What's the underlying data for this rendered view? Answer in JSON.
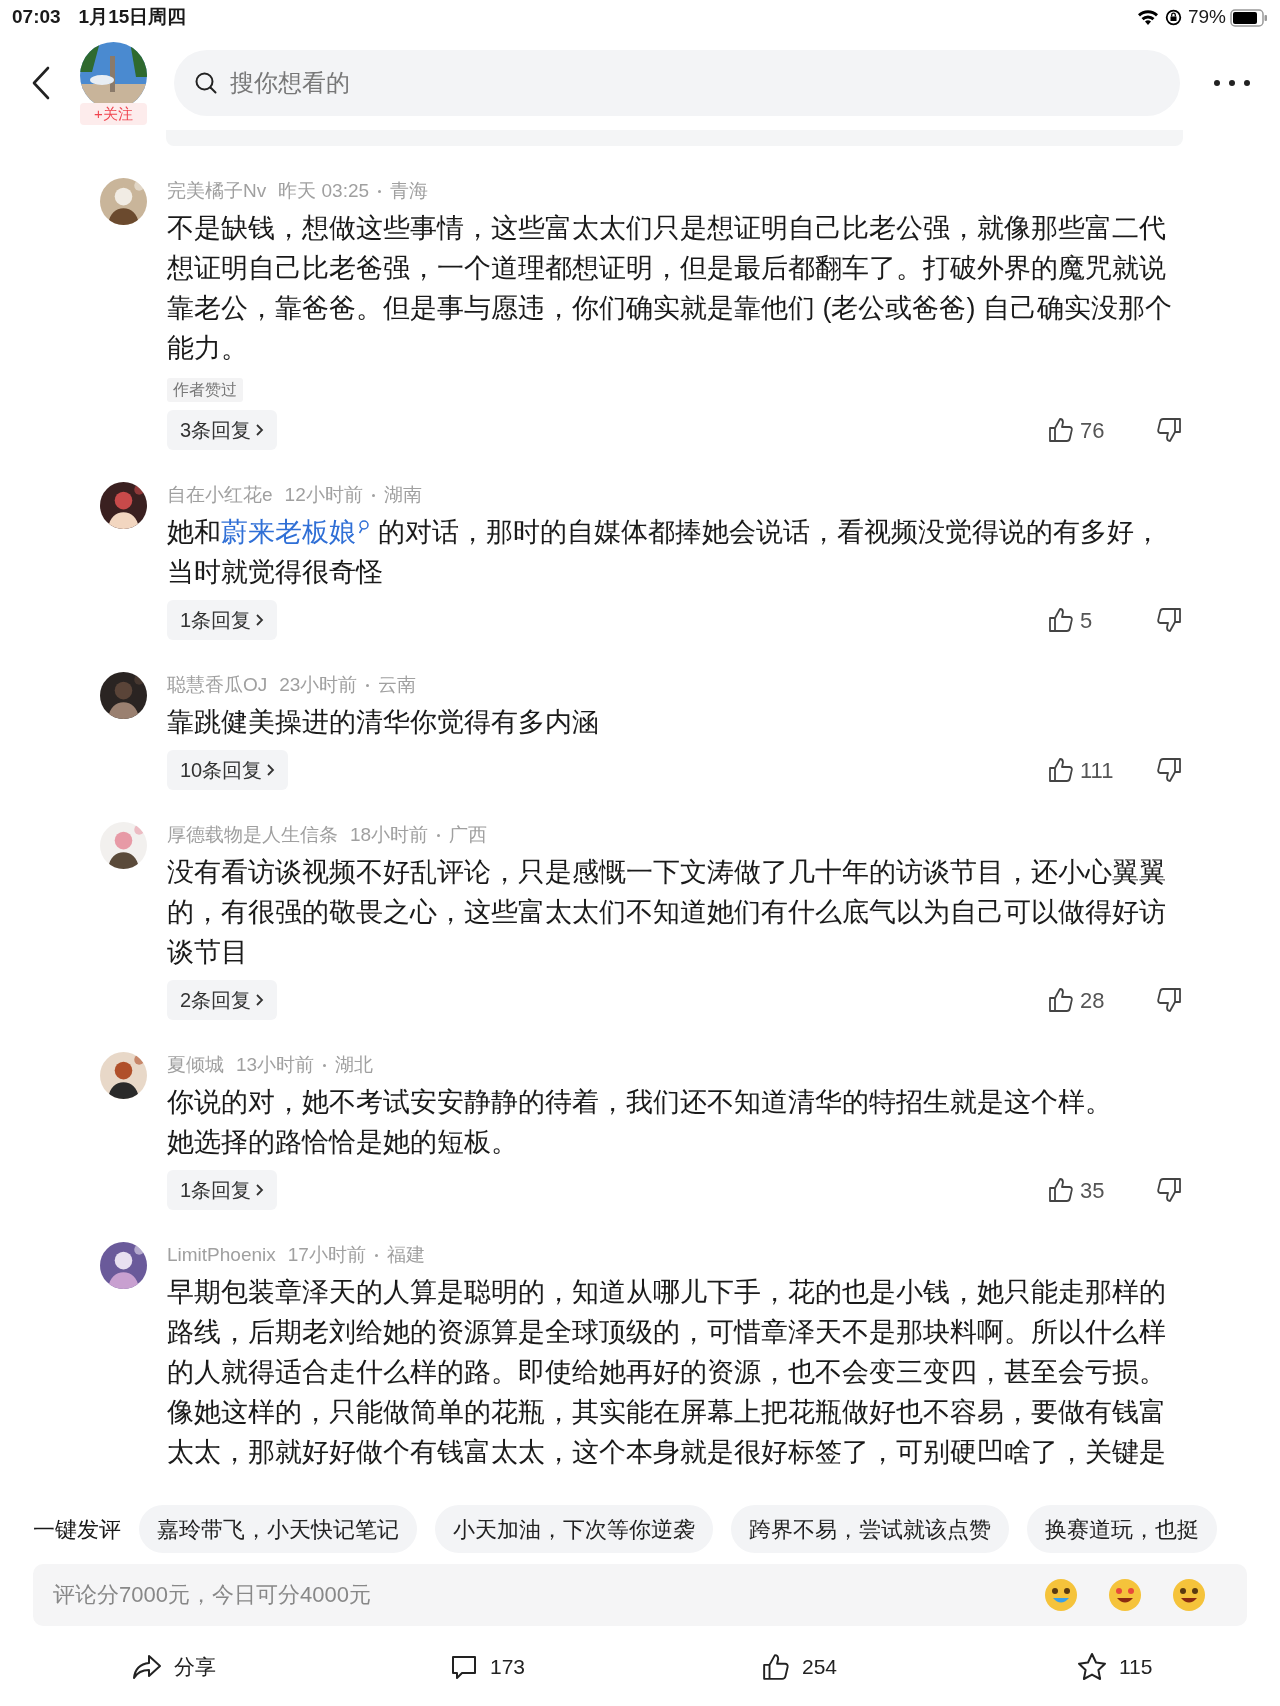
{
  "status_bar": {
    "time": "07:03",
    "date": "1月15日周四",
    "battery": "79%"
  },
  "header": {
    "follow_label": "+关注",
    "search": {
      "placeholder": "搜你想看的"
    }
  },
  "comments": [
    {
      "user": "完美橘子Nv",
      "time": "昨天 03:25",
      "location": "青海",
      "body": [
        {
          "kind": "text",
          "text": "不是缺钱，想做这些事情，这些富太太们只是想证明自己比老公强，就像那些富二代想证明自己比老爸强，一个道理都想证明，但是最后都翻车了。打破外界的魔咒就说靠老公，靠爸爸。但是事与愿违，你们确实就是靠他们 (老公或爸爸) 自己确实没那个能力。"
        }
      ],
      "badge": "作者赞过",
      "replies": "3条回复",
      "likes": "76"
    },
    {
      "user": "自在小红花e",
      "time": "12小时前",
      "location": "湖南",
      "body": [
        {
          "kind": "text",
          "text": "她和"
        },
        {
          "kind": "mention",
          "text": "蔚来老板娘"
        },
        {
          "kind": "text",
          "text": " 的对话，那时的自媒体都捧她会说话，看视频没觉得说的有多好，当时就觉得很奇怪"
        }
      ],
      "replies": "1条回复",
      "likes": "5"
    },
    {
      "user": "聪慧香瓜OJ",
      "time": "23小时前",
      "location": "云南",
      "body": [
        {
          "kind": "text",
          "text": "靠跳健美操进的清华你觉得有多内涵"
        }
      ],
      "replies": "10条回复",
      "likes": "111"
    },
    {
      "user": "厚德载物是人生信条",
      "time": "18小时前",
      "location": "广西",
      "body": [
        {
          "kind": "text",
          "text": "没有看访谈视频不好乱评论，只是感慨一下文涛做了几十年的访谈节目，还小心翼翼的，有很强的敬畏之心，这些富太太们不知道她们有什么底气以为自己可以做得好访谈节目"
        }
      ],
      "replies": "2条回复",
      "likes": "28"
    },
    {
      "user": "夏倾城",
      "time": "13小时前",
      "location": "湖北",
      "body": [
        {
          "kind": "text",
          "text": "你说的对，她不考试安安静静的待着，我们还不知道清华的特招生就是这个样。"
        },
        {
          "kind": "break"
        },
        {
          "kind": "text",
          "text": "她选择的路恰恰是她的短板。"
        }
      ],
      "replies": "1条回复",
      "likes": "35"
    },
    {
      "user": "LimitPhoenix",
      "time": "17小时前",
      "location": "福建",
      "body": [
        {
          "kind": "text",
          "text": "早期包装章泽天的人算是聪明的，知道从哪儿下手，花的也是小钱，她只能走那样的路线，后期老刘给她的资源算是全球顶级的，可惜章泽天不是那块料啊。所以什么样的人就得适合走什么样的路。即使给她再好的资源，也不会变三变四，甚至会亏损。像她这样的，只能做简单的花瓶，其实能在屏幕上把花瓶做好也不容易，要做有钱富太太，那就好好做个有钱富太太，这个本身就是很好标签了，可别硬凹啥了，关键是"
        }
      ]
    }
  ],
  "quick_comments": {
    "label": "一键发评",
    "chips": [
      "嘉玲带飞，小天快记笔记",
      "小天加油，下次等你逆袭",
      "跨界不易，尝试就该点赞",
      "换赛道玩，也挺"
    ]
  },
  "comment_input": {
    "placeholder": "评论分7000元，今日可分4000元"
  },
  "actions": [
    {
      "kind": "share",
      "label": "分享"
    },
    {
      "kind": "comment",
      "label": "173"
    },
    {
      "kind": "like",
      "label": "254"
    },
    {
      "kind": "favorite",
      "label": "115"
    }
  ]
}
